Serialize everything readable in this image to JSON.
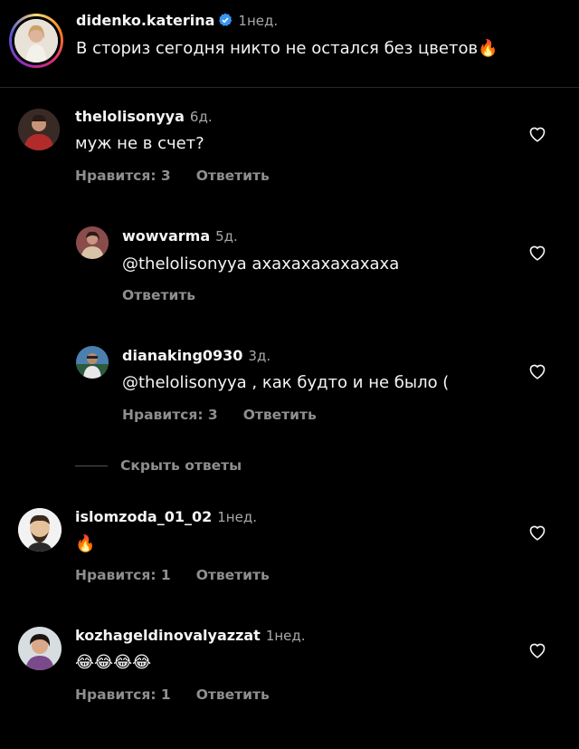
{
  "post": {
    "username": "didenko.katerina",
    "time": "1нед.",
    "caption": "В сториз сегодня никто не остался без цветов🔥",
    "verified_icon": "verified-badge-icon"
  },
  "comments": [
    {
      "username": "thelolisonyya",
      "time": "6д.",
      "text": "муж не в счет?",
      "likes_label": "Нравится: 3",
      "reply_label": "Ответить",
      "replies": [
        {
          "username": "wowvarma",
          "time": "5д.",
          "text": "@thelolisonyya ахахахахахахаха",
          "reply_label": "Ответить"
        },
        {
          "username": "dianaking0930",
          "time": "3д.",
          "text": "@thelolisonyya , как будто и не было (",
          "likes_label": "Нравится: 3",
          "reply_label": "Ответить"
        }
      ],
      "hide_replies_label": "Скрыть ответы"
    },
    {
      "username": "islomzoda_01_02",
      "time": "1нед.",
      "text": "🔥",
      "likes_label": "Нравится: 1",
      "reply_label": "Ответить"
    },
    {
      "username": "kozhageldinovalyazzat",
      "time": "1нед.",
      "text": "😂😂😂😂",
      "likes_label": "Нравится: 1",
      "reply_label": "Ответить"
    }
  ],
  "colors": {
    "background": "#000000",
    "text": "#f5f5f5",
    "secondary": "#8e8e8e",
    "verified": "#3897f0"
  }
}
